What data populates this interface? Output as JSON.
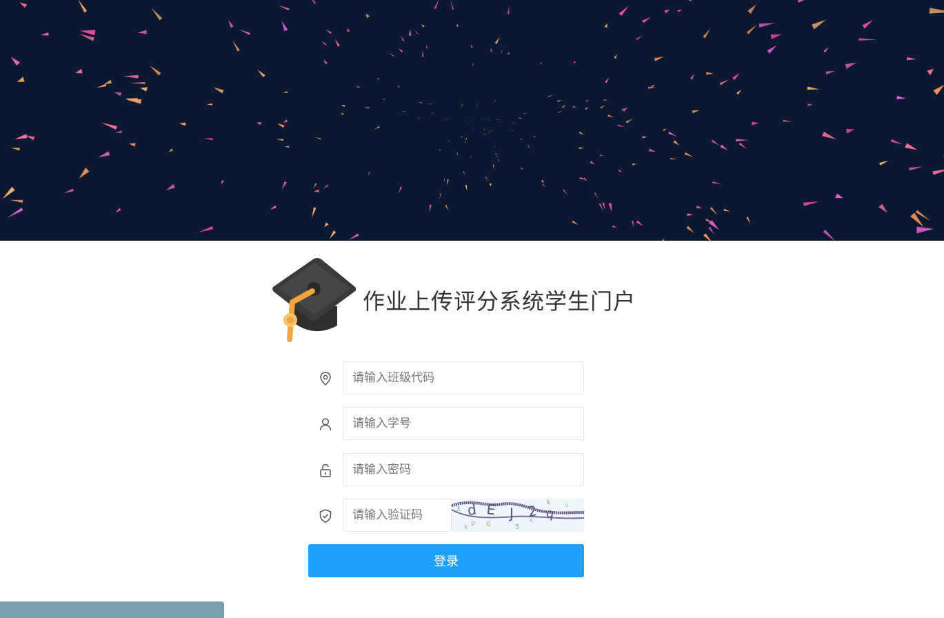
{
  "header": {
    "background_color": "#0a1830",
    "confetti_colors": [
      "#ff6fa1",
      "#ff9a5c",
      "#e65fcf",
      "#ffb36b",
      "#ff4fa6"
    ]
  },
  "brand": {
    "logo_icon": "graduation-cap-icon",
    "title": "作业上传评分系统学生门户"
  },
  "form": {
    "class_code": {
      "icon": "location-pin-icon",
      "placeholder": "请输入班级代码",
      "value": ""
    },
    "student_id": {
      "icon": "user-icon",
      "placeholder": "请输入学号",
      "value": ""
    },
    "password": {
      "icon": "unlock-icon",
      "placeholder": "请输入密码",
      "value": ""
    },
    "captcha": {
      "icon": "shield-check-icon",
      "placeholder": "请输入验证码",
      "value": "",
      "image_text": "dEJ2q"
    },
    "login_label": "登录",
    "accent_color": "#1fa0ff"
  }
}
